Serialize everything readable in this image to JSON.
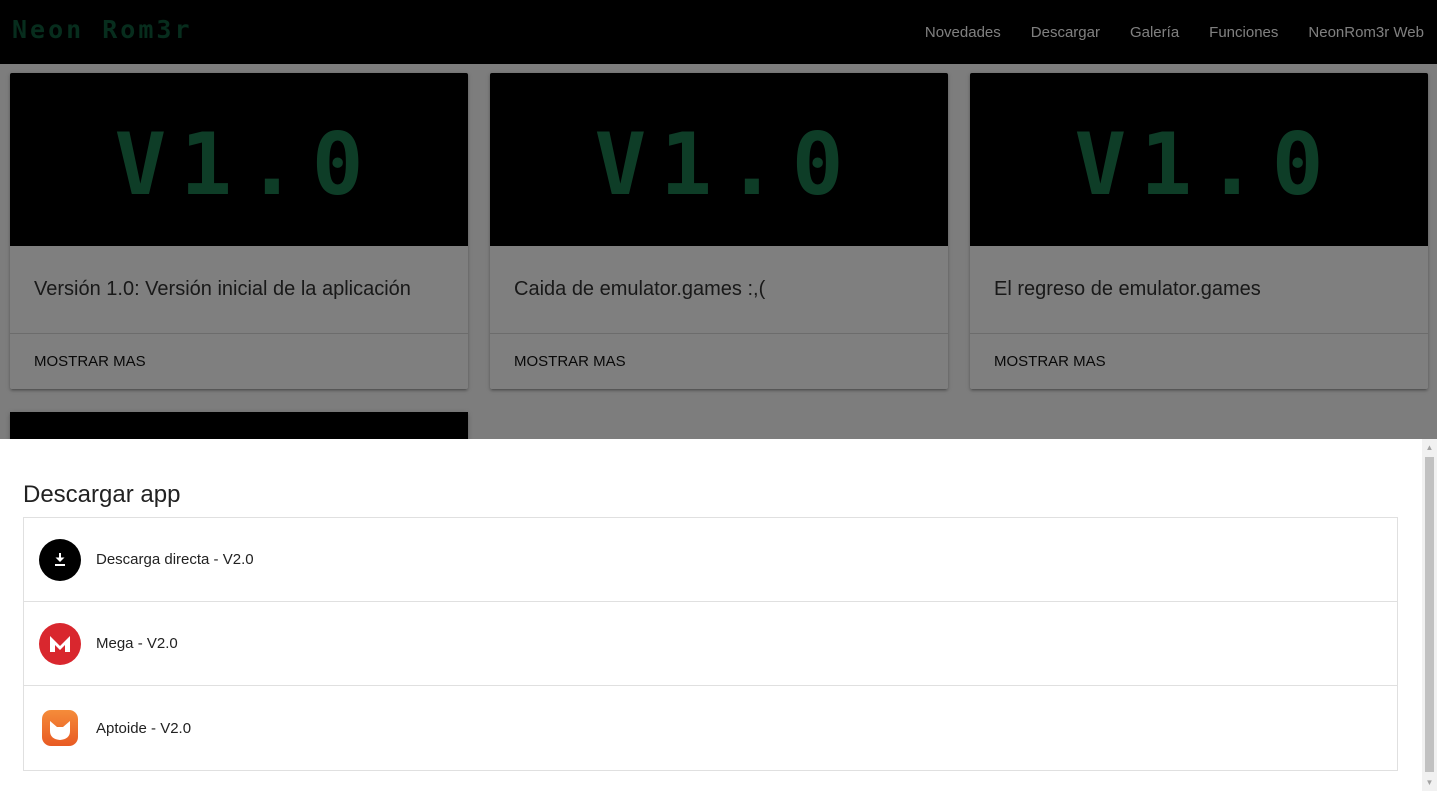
{
  "navbar": {
    "brand": "Neon Rom3r",
    "links": [
      "Novedades",
      "Descargar",
      "Galería",
      "Funciones",
      "NeonRom3r Web"
    ]
  },
  "cards": [
    {
      "image_text": "V1.0",
      "title": "Versión 1.0: Versión inicial de la aplicación",
      "action": "MOSTRAR MAS"
    },
    {
      "image_text": "V1.0",
      "title": "Caida de emulator.games :,(",
      "action": "MOSTRAR MAS"
    },
    {
      "image_text": "V1.0",
      "title": "El regreso de emulator.games",
      "action": "MOSTRAR MAS"
    }
  ],
  "modal": {
    "title": "Descargar app",
    "items": [
      {
        "label": "Descarga directa - V2.0",
        "icon": "download-icon"
      },
      {
        "label": "Mega - V2.0",
        "icon": "mega-icon"
      },
      {
        "label": "Aptoide - V2.0",
        "icon": "aptoide-icon"
      }
    ]
  },
  "colors": {
    "brand": "#0e5a3a",
    "image_text": "#1c7a4f",
    "mega": "#d9272e",
    "aptoide": "#f26b2a"
  }
}
